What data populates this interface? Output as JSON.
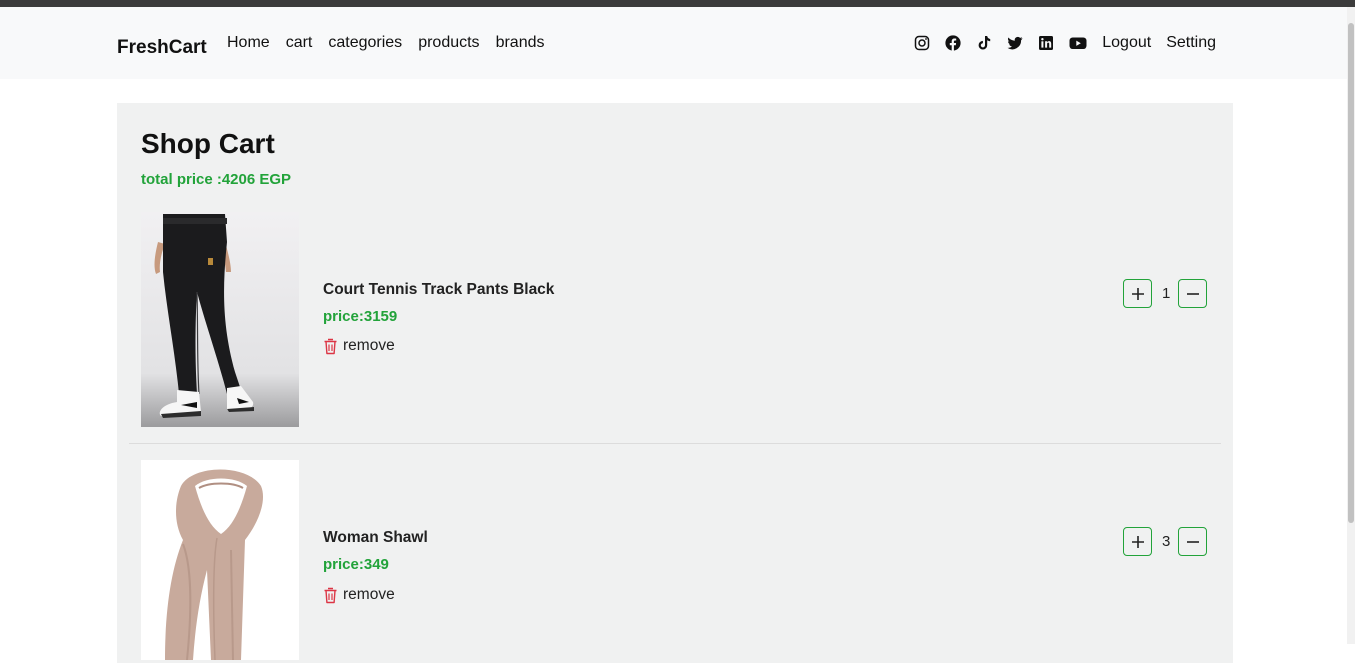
{
  "nav": {
    "brand": "FreshCart",
    "links": [
      "Home",
      "cart",
      "categories",
      "products",
      "brands"
    ],
    "icons": [
      "instagram-icon",
      "facebook-icon",
      "tiktok-icon",
      "twitter-icon",
      "linkedin-icon",
      "youtube-icon"
    ],
    "logout": "Logout",
    "setting": "Setting"
  },
  "cart": {
    "title": "Shop Cart",
    "total": "total price :4206 EGP",
    "items": [
      {
        "name": "Court Tennis Track Pants Black",
        "price": "price:3159",
        "remove": "remove",
        "qty": "1"
      },
      {
        "name": "Woman Shawl",
        "price": "price:349",
        "remove": "remove",
        "qty": "3"
      }
    ]
  },
  "colors": {
    "accent": "#22a33a",
    "remove": "#dc3545",
    "cart_bg": "#f0f1f1",
    "nav_bg": "#f8f9fa"
  }
}
